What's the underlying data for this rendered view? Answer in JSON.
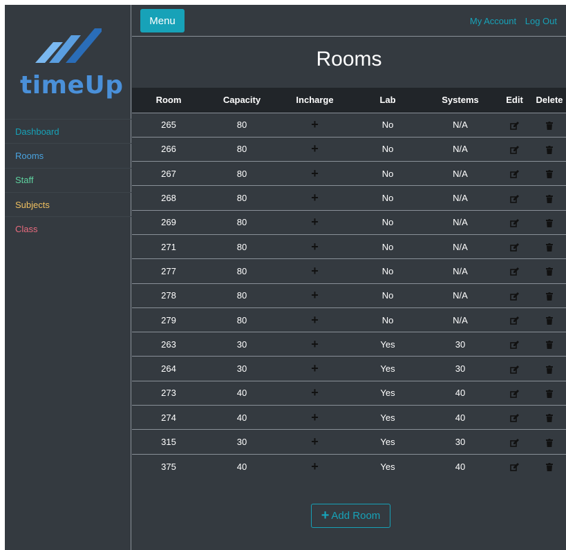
{
  "app": {
    "logo_text": "timeUp"
  },
  "sidebar": {
    "items": [
      {
        "label": "Dashboard",
        "color": "#17a2b8"
      },
      {
        "label": "Rooms",
        "color": "#4aa3df"
      },
      {
        "label": "Staff",
        "color": "#5fd3a0"
      },
      {
        "label": "Subjects",
        "color": "#f0c060"
      },
      {
        "label": "Class",
        "color": "#e86b7e"
      }
    ]
  },
  "topbar": {
    "menu_label": "Menu",
    "my_account_label": "My Account",
    "logout_label": "Log Out"
  },
  "page": {
    "title": "Rooms"
  },
  "table": {
    "headers": [
      "Room",
      "Capacity",
      "Incharge",
      "Lab",
      "Systems",
      "Edit",
      "Delete"
    ],
    "rows": [
      {
        "room": "265",
        "capacity": "80",
        "lab": "No",
        "systems": "N/A"
      },
      {
        "room": "266",
        "capacity": "80",
        "lab": "No",
        "systems": "N/A"
      },
      {
        "room": "267",
        "capacity": "80",
        "lab": "No",
        "systems": "N/A"
      },
      {
        "room": "268",
        "capacity": "80",
        "lab": "No",
        "systems": "N/A"
      },
      {
        "room": "269",
        "capacity": "80",
        "lab": "No",
        "systems": "N/A"
      },
      {
        "room": "271",
        "capacity": "80",
        "lab": "No",
        "systems": "N/A"
      },
      {
        "room": "277",
        "capacity": "80",
        "lab": "No",
        "systems": "N/A"
      },
      {
        "room": "278",
        "capacity": "80",
        "lab": "No",
        "systems": "N/A"
      },
      {
        "room": "279",
        "capacity": "80",
        "lab": "No",
        "systems": "N/A"
      },
      {
        "room": "263",
        "capacity": "30",
        "lab": "Yes",
        "systems": "30"
      },
      {
        "room": "264",
        "capacity": "30",
        "lab": "Yes",
        "systems": "30"
      },
      {
        "room": "273",
        "capacity": "40",
        "lab": "Yes",
        "systems": "40"
      },
      {
        "room": "274",
        "capacity": "40",
        "lab": "Yes",
        "systems": "40"
      },
      {
        "room": "315",
        "capacity": "30",
        "lab": "Yes",
        "systems": "30"
      },
      {
        "room": "375",
        "capacity": "40",
        "lab": "Yes",
        "systems": "40"
      }
    ],
    "incharge_icon": "plus-icon",
    "edit_icon": "edit-icon",
    "delete_icon": "trash-icon"
  },
  "actions": {
    "add_room_label": "Add Room"
  },
  "colors": {
    "accent": "#17a2b8",
    "background": "#343a40",
    "header": "#212529"
  }
}
